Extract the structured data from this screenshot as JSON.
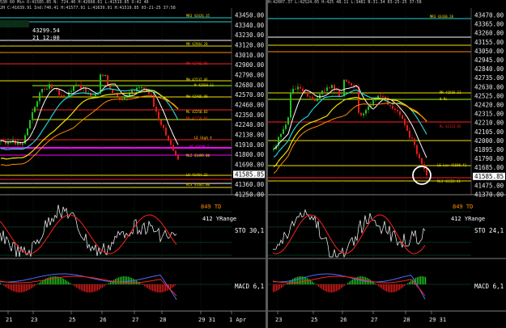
{
  "left": {
    "header": "530 60 Min  O:41585.85  N: 724.40  H:42668.61 L:41519.85 O:42 46",
    "header2": "2H  C:41639.91  Ind:740.41  H:41577.91 L:41639.91 H:41519.85 03-21-25 37:58",
    "price_box": "43299.54",
    "time_box": "21 12:00",
    "axis_prices": [
      "43450.00",
      "43340.00",
      "43230.00",
      "43120.00",
      "43010.00",
      "42900.00",
      "42790.00",
      "42680.00",
      "42570.00",
      "42460.00",
      "42350.00",
      "42240.00",
      "42130.00",
      "41910.00",
      "41800.00",
      "41690.00",
      "41585.85",
      "41360.00",
      "41250.00"
    ],
    "current_price": "41585.85",
    "level_labels": [
      "MR3 43426.35",
      "MR 42984.28",
      "MH 42702.96",
      "MH 42532.46",
      "M 42560.11",
      "MH 42400.90",
      "ML 42250.83",
      "MR 42250.88",
      "LE High 4",
      "HF 41600.7",
      "ML2 41499.00",
      "LR 41484.22",
      "ML 41470.9",
      "RLS 41465.00"
    ],
    "td_label": "849 TD",
    "yrange_label": "412 YRange",
    "sto_label": "STO 30,1",
    "macd_label": "MACD 6,1",
    "dates": [
      "21",
      "23",
      "25",
      "26",
      "27",
      "28",
      "29 31",
      "1 Apr"
    ]
  },
  "right": {
    "header": "H:42007.37  L:42524.05  H:425 48.11  L:3481  B:31.34  03-25-25 37:58",
    "header2": "",
    "axis_prices": [
      "43470.00",
      "43365.00",
      "43260.00",
      "43155.00",
      "43050.00",
      "42945.00",
      "42840.00",
      "42735.00",
      "42630.00",
      "42525.00",
      "42420.00",
      "42315.00",
      "42210.00",
      "42105.00",
      "42000.00",
      "41895.00",
      "41790.00",
      "41685.00",
      "41585.85",
      "41475.00",
      "41370.00"
    ],
    "current_price": "41585.85",
    "level_labels": [
      "MR3 43430.28",
      "MR 42566.11",
      "0 Rs",
      "RL 42153.65",
      "LE Low 41608.41",
      "ML3 41522.41",
      "MR 42360.48"
    ],
    "td_label": "849 TD",
    "yrange_label": "412 YRange",
    "sto_label": "STO 24,1",
    "macd_label": "MACD 6,1",
    "dates": [
      "23",
      "25",
      "26",
      "27",
      "28",
      "29 31"
    ]
  },
  "colors": {
    "up": "#22c21e",
    "down": "#e31a1a",
    "red": "#ff2020",
    "yellow": "#f2e200",
    "cyan": "#1fd3d3",
    "magenta": "#ff00ff",
    "white": "#ffffff",
    "orange": "#ff8a00",
    "lime": "#9cff00",
    "grid": "#0c6a36"
  }
}
